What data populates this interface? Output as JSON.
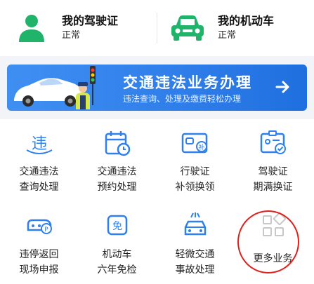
{
  "top_cards": [
    {
      "title": "我的驾驶证",
      "status": "正常",
      "icon": "person-icon"
    },
    {
      "title": "我的机动车",
      "status": "正常",
      "icon": "car-icon"
    }
  ],
  "banner": {
    "title": "交通违法业务办理",
    "subtitle": "违法查询、处理及缴费轻松办理",
    "arrow_icon": "arrow-right-icon"
  },
  "services": [
    {
      "line1": "交通违法",
      "line2": "查询处理",
      "icon": "violation-icon"
    },
    {
      "line1": "交通违法",
      "line2": "预约处理",
      "icon": "calendar-icon"
    },
    {
      "line1": "行驶证",
      "line2": "补领换领",
      "icon": "vehicle-license-icon"
    },
    {
      "line1": "驾驶证",
      "line2": "期满换证",
      "icon": "driver-license-icon"
    },
    {
      "line1": "违停返回",
      "line2": "现场申报",
      "icon": "parked-car-icon"
    },
    {
      "line1": "机动车",
      "line2": "六年免检",
      "icon": "exempt-icon"
    },
    {
      "line1": "轻微交通",
      "line2": "事故处理",
      "icon": "accident-icon"
    },
    {
      "line1": "更多业务",
      "line2": "",
      "icon": "more-grid-icon"
    }
  ],
  "colors": {
    "green": "#20b46a",
    "blue": "#2f80ed",
    "accent_red": "#e0201c"
  }
}
